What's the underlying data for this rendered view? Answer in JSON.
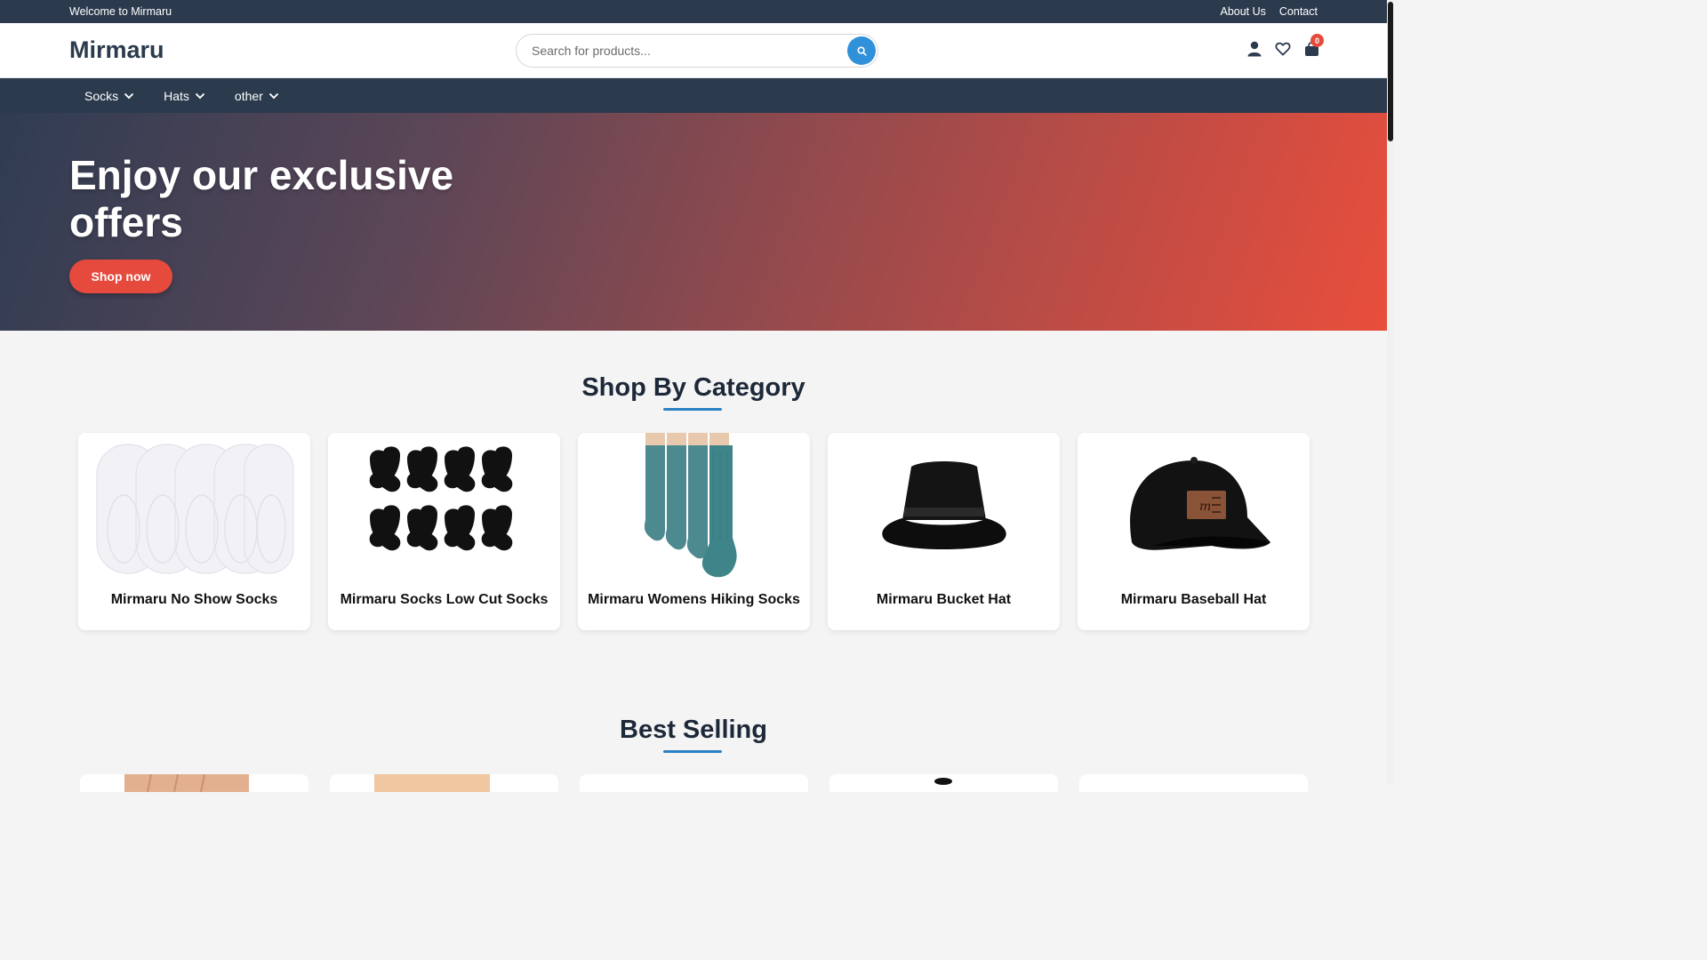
{
  "topbar": {
    "welcome": "Welcome to Mirmaru",
    "links": [
      "About Us",
      "Contact"
    ]
  },
  "header": {
    "logo": "Mirmaru",
    "search_placeholder": "Search for products...",
    "cart_count": "0"
  },
  "nav": {
    "items": [
      "Socks",
      "Hats",
      "other"
    ]
  },
  "hero": {
    "title": "Enjoy our exclusive offers",
    "cta": "Shop now"
  },
  "categories": {
    "title": "Shop By Category",
    "items": [
      "Mirmaru No Show Socks",
      "Mirmaru Socks Low Cut Socks",
      "Mirmaru Womens Hiking Socks",
      "Mirmaru Bucket Hat",
      "Mirmaru Baseball Hat"
    ]
  },
  "best_selling": {
    "title": "Best Selling"
  },
  "colors": {
    "primary": "#2b3a4d",
    "accent": "#e64a3c",
    "search_button": "#3090d9"
  }
}
